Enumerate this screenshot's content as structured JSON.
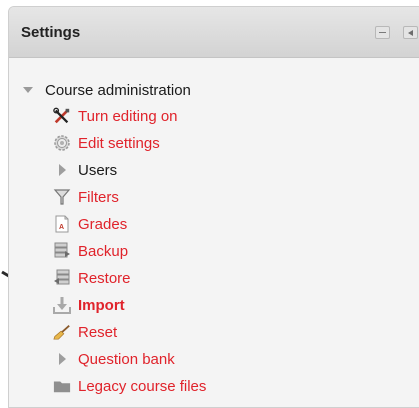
{
  "block": {
    "title": "Settings",
    "root_label": "Course administration",
    "items": [
      {
        "label": "Turn editing on",
        "icon": "tools-icon"
      },
      {
        "label": "Edit settings",
        "icon": "gear-icon"
      },
      {
        "label": "Users",
        "icon": "expand-arrow-icon"
      },
      {
        "label": "Filters",
        "icon": "filter-icon"
      },
      {
        "label": "Grades",
        "icon": "grades-icon"
      },
      {
        "label": "Backup",
        "icon": "backup-icon"
      },
      {
        "label": "Restore",
        "icon": "restore-icon"
      },
      {
        "label": "Import",
        "icon": "import-icon"
      },
      {
        "label": "Reset",
        "icon": "broom-icon"
      },
      {
        "label": "Question bank",
        "icon": "expand-arrow-icon"
      },
      {
        "label": "Legacy course files",
        "icon": "folder-icon"
      }
    ]
  },
  "colors": {
    "link": "#e0232b",
    "text": "#1a1a1a",
    "header": "#d9d9d9"
  }
}
